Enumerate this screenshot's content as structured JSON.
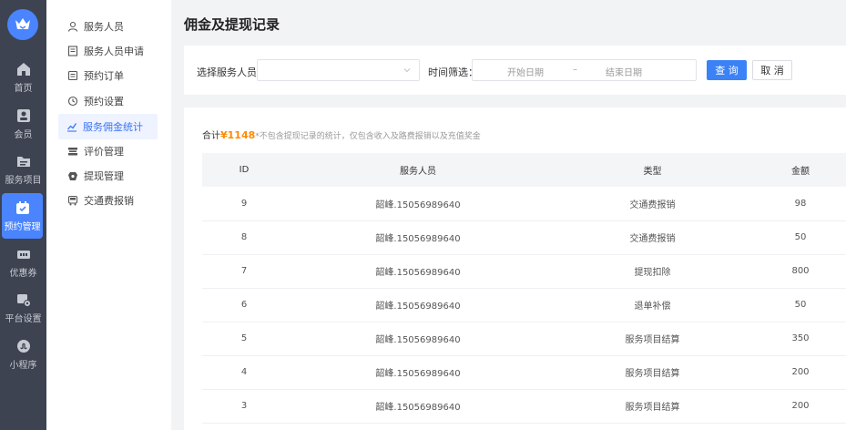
{
  "rail": {
    "items": [
      {
        "label": "首页",
        "icon": "home-icon"
      },
      {
        "label": "会员",
        "icon": "member-icon"
      },
      {
        "label": "服务项目",
        "icon": "folder-icon"
      },
      {
        "label": "预约管理",
        "icon": "calendar-check-icon"
      },
      {
        "label": "优惠券",
        "icon": "ticket-icon"
      },
      {
        "label": "平台设置",
        "icon": "settings-icon"
      },
      {
        "label": "小程序",
        "icon": "mini-program-icon"
      }
    ],
    "active_index": 3,
    "accent": "#4a84ff"
  },
  "submenu": {
    "items": [
      {
        "label": "服务人员",
        "icon": "user-icon"
      },
      {
        "label": "服务人员申请",
        "icon": "form-icon"
      },
      {
        "label": "预约订单",
        "icon": "order-icon"
      },
      {
        "label": "预约设置",
        "icon": "clock-gear-icon"
      },
      {
        "label": "服务佣金统计",
        "icon": "trend-chart-icon"
      },
      {
        "label": "评价管理",
        "icon": "review-icon"
      },
      {
        "label": "提现管理",
        "icon": "withdraw-icon"
      },
      {
        "label": "交通费报销",
        "icon": "bus-icon"
      }
    ],
    "active_index": 4
  },
  "page": {
    "title": "佣金及提现记录"
  },
  "filter": {
    "staff_label": "选择服务人员：",
    "staff_value": "",
    "time_label": "时间筛选：",
    "start_placeholder": "开始日期",
    "separator": "–",
    "end_placeholder": "结束日期",
    "query_button": "查 询",
    "cancel_button": "取 消"
  },
  "summary": {
    "label": "合计",
    "amount": "¥1148",
    "note": "*不包含提现记录的统计，仅包含收入及路费报销以及充值奖金"
  },
  "table": {
    "headers": [
      "ID",
      "服务人员",
      "类型",
      "金额"
    ],
    "rows": [
      [
        "9",
        "韶峰.15056989640",
        "交通费报销",
        "98"
      ],
      [
        "8",
        "韶峰.15056989640",
        "交通费报销",
        "50"
      ],
      [
        "7",
        "韶峰.15056989640",
        "提现扣除",
        "800"
      ],
      [
        "6",
        "韶峰.15056989640",
        "退单补偿",
        "50"
      ],
      [
        "5",
        "韶峰.15056989640",
        "服务项目结算",
        "350"
      ],
      [
        "4",
        "韶峰.15056989640",
        "服务项目结算",
        "200"
      ],
      [
        "3",
        "韶峰.15056989640",
        "服务项目结算",
        "200"
      ]
    ]
  }
}
